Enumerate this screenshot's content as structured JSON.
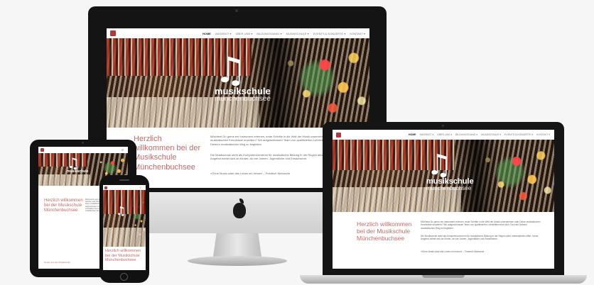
{
  "site": {
    "nav": {
      "home": "HOME",
      "items": [
        "ANGEBOT ▾",
        "ÜBER UNS ▾",
        "BILDUNGSGANG ▾",
        "MUSIKSCHULE ▾",
        "EVENTS & KONZERTE ▾",
        "KONTAKT ▾"
      ]
    },
    "brand": {
      "mark": "♫",
      "name": "musikschule",
      "place": "münchenbuchsee"
    },
    "welcome": "Herzlich willkommen bei der Musikschule Münchenbuchsee",
    "intro": "Möchtest Du gerne ein Instrument erlernen, erste Schritte in die Welt der Musik unternehmen oder Deine musikalischen Kenntnisse erweitern? Wir aufgeschlossen Team von qualifizierten Lehrkräften freut sich, Dich auf Deinem musikalischen Weg zu begleiten.",
    "intro2": "Die Musikschule steht als Kompetenzzentrum für musikalische Bildung in der Region allen Interessierten offen. Unser Angebot richtet sich an Kinder, ab vier Jahren, Jugendliche und Erwachsene.",
    "quote": "«Ohne Musik wäre das Leben ein Irrtum» – Friedrich Nietzsche",
    "footer_link": "Neues aus der Musikschule"
  },
  "devices": {
    "desktop_logo": ""
  },
  "colors": {
    "accent": "#b23a3a",
    "welcome_text": "#c26a6a",
    "background": "#f6f6f6"
  }
}
